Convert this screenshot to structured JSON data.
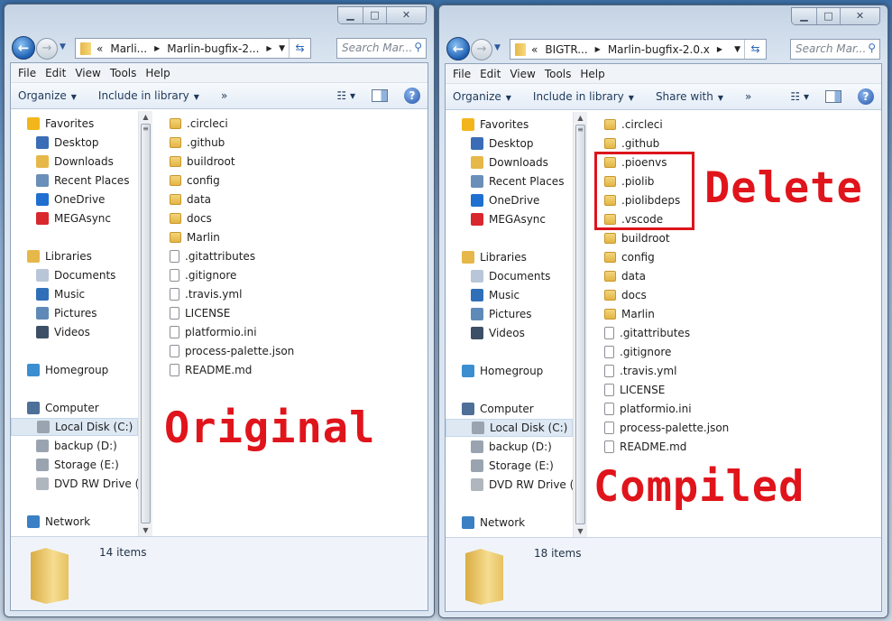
{
  "windows": [
    {
      "breadcrumb": [
        "Marli...",
        "Marlin-bugfix-2..."
      ],
      "search_placeholder": "Search Mar...",
      "menu": [
        "File",
        "Edit",
        "View",
        "Tools",
        "Help"
      ],
      "toolbar": [
        "Organize",
        "Include in library"
      ],
      "more": "»",
      "status": "14 items",
      "files": [
        {
          "name": ".circleci",
          "type": "folder"
        },
        {
          "name": ".github",
          "type": "folder"
        },
        {
          "name": "buildroot",
          "type": "folder"
        },
        {
          "name": "config",
          "type": "folder"
        },
        {
          "name": "data",
          "type": "folder"
        },
        {
          "name": "docs",
          "type": "folder"
        },
        {
          "name": "Marlin",
          "type": "folder"
        },
        {
          "name": ".gitattributes",
          "type": "file"
        },
        {
          "name": ".gitignore",
          "type": "file"
        },
        {
          "name": ".travis.yml",
          "type": "file"
        },
        {
          "name": "LICENSE",
          "type": "file"
        },
        {
          "name": "platformio.ini",
          "type": "settings"
        },
        {
          "name": "process-palette.json",
          "type": "script"
        },
        {
          "name": "README.md",
          "type": "doc"
        }
      ]
    },
    {
      "breadcrumb": [
        "BIGTR...",
        "Marlin-bugfix-2.0.x"
      ],
      "search_placeholder": "Search Mar...",
      "menu": [
        "File",
        "Edit",
        "View",
        "Tools",
        "Help"
      ],
      "toolbar": [
        "Organize",
        "Include in library",
        "Share with"
      ],
      "more": "»",
      "status": "18 items",
      "files": [
        {
          "name": ".circleci",
          "type": "folder"
        },
        {
          "name": ".github",
          "type": "folder"
        },
        {
          "name": ".pioenvs",
          "type": "folder"
        },
        {
          "name": ".piolib",
          "type": "folder"
        },
        {
          "name": ".piolibdeps",
          "type": "folder"
        },
        {
          "name": ".vscode",
          "type": "folder"
        },
        {
          "name": "buildroot",
          "type": "folder"
        },
        {
          "name": "config",
          "type": "folder"
        },
        {
          "name": "data",
          "type": "folder"
        },
        {
          "name": "docs",
          "type": "folder"
        },
        {
          "name": "Marlin",
          "type": "folder"
        },
        {
          "name": ".gitattributes",
          "type": "file"
        },
        {
          "name": ".gitignore",
          "type": "file"
        },
        {
          "name": ".travis.yml",
          "type": "file"
        },
        {
          "name": "LICENSE",
          "type": "file"
        },
        {
          "name": "platformio.ini",
          "type": "settings"
        },
        {
          "name": "process-palette.json",
          "type": "script"
        },
        {
          "name": "README.md",
          "type": "doc"
        }
      ]
    }
  ],
  "nav_items": [
    {
      "label": "Favorites",
      "icon": "star-icon",
      "color": "#f2b51c",
      "group": 0
    },
    {
      "label": "Desktop",
      "icon": "desktop-icon",
      "color": "#3a6db5",
      "group": 0
    },
    {
      "label": "Downloads",
      "icon": "downloads-folder-icon",
      "color": "#e6b84a",
      "group": 0
    },
    {
      "label": "Recent Places",
      "icon": "recent-places-icon",
      "color": "#6a8fb8",
      "group": 0
    },
    {
      "label": "OneDrive",
      "icon": "onedrive-cloud-icon",
      "color": "#1e6fd0",
      "group": 0
    },
    {
      "label": "MEGAsync",
      "icon": "mega-icon",
      "color": "#d9272e",
      "group": 0
    },
    {
      "label": "Libraries",
      "icon": "libraries-icon",
      "color": "#e6b84a",
      "group": 1
    },
    {
      "label": "Documents",
      "icon": "documents-icon",
      "color": "#b8c6d8",
      "group": 1
    },
    {
      "label": "Music",
      "icon": "music-icon",
      "color": "#2e6fb8",
      "group": 1
    },
    {
      "label": "Pictures",
      "icon": "pictures-icon",
      "color": "#5f8ab8",
      "group": 1
    },
    {
      "label": "Videos",
      "icon": "videos-icon",
      "color": "#3d4f66",
      "group": 1
    },
    {
      "label": "Homegroup",
      "icon": "homegroup-icon",
      "color": "#3b8fd0",
      "group": 2
    },
    {
      "label": "Computer",
      "icon": "computer-icon",
      "color": "#4d6f98",
      "group": 3
    },
    {
      "label": "Local Disk (C:)",
      "icon": "local-disk-icon",
      "color": "#9aa4b0",
      "group": 3,
      "selected": true
    },
    {
      "label": "backup (D:)",
      "icon": "drive-icon",
      "color": "#9aa4b0",
      "group": 3
    },
    {
      "label": "Storage (E:)",
      "icon": "drive-icon",
      "color": "#9aa4b0",
      "group": 3
    },
    {
      "label": "DVD RW Drive (F:)",
      "icon": "dvd-drive-icon",
      "color": "#b0b6bd",
      "group": 3
    },
    {
      "label": "Network",
      "icon": "network-icon",
      "color": "#3b7fc4",
      "group": 4
    }
  ],
  "annotations": {
    "left": "Original",
    "right": "Compiled",
    "delete": "Delete"
  },
  "colors": {
    "annotation": "#e0141b",
    "folder": "#e6b84a",
    "selection": "#dde8f3"
  }
}
